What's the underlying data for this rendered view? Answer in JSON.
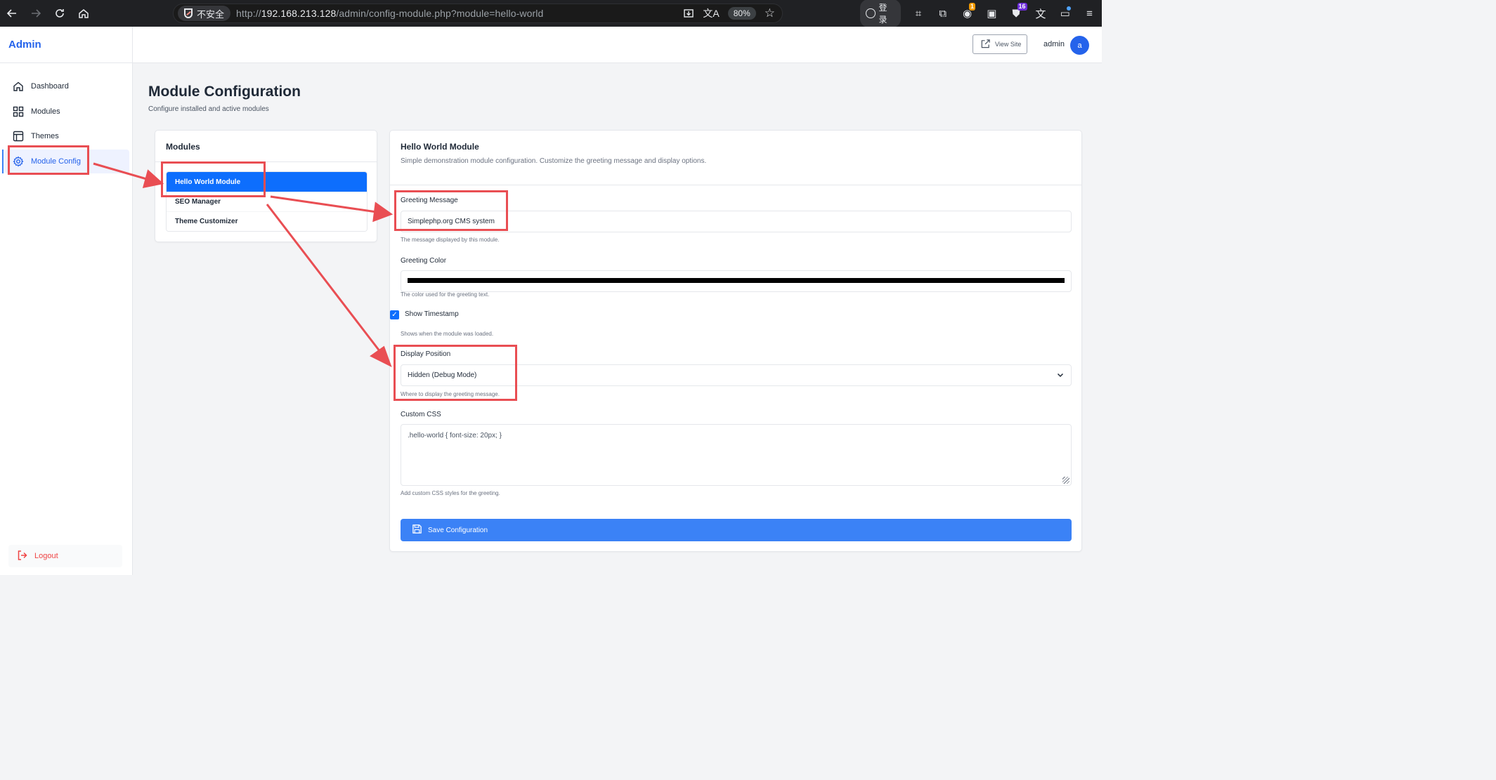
{
  "browser": {
    "security_label": "不安全",
    "url_prefix": "http://",
    "url_host": "192.168.213.128",
    "url_path": "/admin/config-module.php?module=hello-world",
    "zoom": "80%",
    "login_label": "登录",
    "ext_badge_1": "1",
    "ext_badge_2": "16"
  },
  "sidebar": {
    "brand": "Admin",
    "items": [
      {
        "label": "Dashboard",
        "icon": "home-icon"
      },
      {
        "label": "Modules",
        "icon": "grid-icon"
      },
      {
        "label": "Themes",
        "icon": "layout-icon"
      },
      {
        "label": "Module Config",
        "icon": "gear-icon",
        "active": true
      }
    ],
    "logout_label": "Logout"
  },
  "header": {
    "view_site_label": "View Site",
    "username": "admin",
    "avatar_initial": "a"
  },
  "page": {
    "title": "Module Configuration",
    "subtitle": "Configure installed and active modules"
  },
  "modules_panel": {
    "title": "Modules",
    "items": [
      {
        "label": "Hello World Module",
        "active": true
      },
      {
        "label": "SEO Manager",
        "active": false
      },
      {
        "label": "Theme Customizer",
        "active": false
      }
    ]
  },
  "config": {
    "title": "Hello World Module",
    "description": "Simple demonstration module configuration. Customize the greeting message and display options.",
    "greeting_message": {
      "label": "Greeting Message",
      "value": "Simplephp.org CMS system",
      "help": "The message displayed by this module."
    },
    "greeting_color": {
      "label": "Greeting Color",
      "value": "#000000",
      "help": "The color used for the greeting text."
    },
    "show_timestamp": {
      "label": "Show Timestamp",
      "checked": true,
      "help": "Shows when the module was loaded."
    },
    "display_position": {
      "label": "Display Position",
      "value": "Hidden (Debug Mode)",
      "help": "Where to display the greeting message."
    },
    "custom_css": {
      "label": "Custom CSS",
      "value": ".hello-world { font-size: 20px; }",
      "help": "Add custom CSS styles for the greeting."
    },
    "save_label": "Save Configuration"
  },
  "colors": {
    "primary": "#0d6efd",
    "brand": "#2563eb",
    "annotation": "#e94e53",
    "logout": "#ef4444"
  }
}
